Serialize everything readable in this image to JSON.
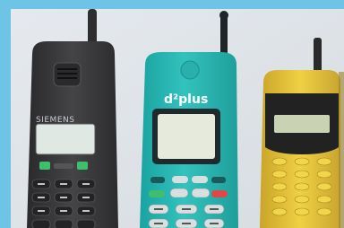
{
  "photo": {
    "phones": [
      {
        "brand": "SIEMENS",
        "body_color": "#3a3a3c",
        "screen_color": "#dfe8e2"
      },
      {
        "brand": "d²plus",
        "body_color": "#29b8b4",
        "screen_color": "#e6eadc"
      },
      {
        "brand": "",
        "body_color": "#e6c63a",
        "screen_color": "#c9d3b4"
      }
    ],
    "colors": {
      "border": "#6ec4e6",
      "wall": "#e2e6ea"
    }
  }
}
